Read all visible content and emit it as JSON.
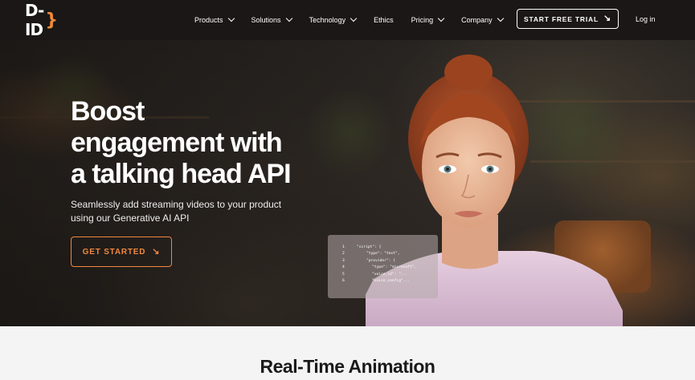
{
  "brand": {
    "logo_text": "D-ID",
    "logo_brace": "}"
  },
  "nav": {
    "items": [
      {
        "label": "Products",
        "has_dropdown": true
      },
      {
        "label": "Solutions",
        "has_dropdown": true
      },
      {
        "label": "Technology",
        "has_dropdown": true
      },
      {
        "label": "Ethics",
        "has_dropdown": false
      },
      {
        "label": "Pricing",
        "has_dropdown": true
      },
      {
        "label": "Company",
        "has_dropdown": true
      }
    ],
    "cta_label": "START FREE TRIAL",
    "login_label": "Log in"
  },
  "hero": {
    "title_line1": "Boost",
    "title_line2": "engagement with",
    "title_line3": "a talking head API",
    "subtitle": "Seamlessly add streaming videos to your product using our Generative AI API",
    "cta_label": "GET STARTED"
  },
  "code_card": {
    "lines": [
      {
        "num": "1",
        "text": "\"script\": {"
      },
      {
        "num": "2",
        "text": "\"type\": \"text\","
      },
      {
        "num": "3",
        "text": "\"provider\": {"
      },
      {
        "num": "4",
        "text": "\"type\": \"microsoft\","
      },
      {
        "num": "5",
        "text": "\"voice_id\": \"..."
      },
      {
        "num": "6",
        "text": "\"voice_config\"..."
      }
    ]
  },
  "section": {
    "title": "Real-Time Animation"
  },
  "colors": {
    "accent": "#f08840",
    "nav_bg": "#1a1716",
    "section_bg": "#f5f4f4"
  }
}
